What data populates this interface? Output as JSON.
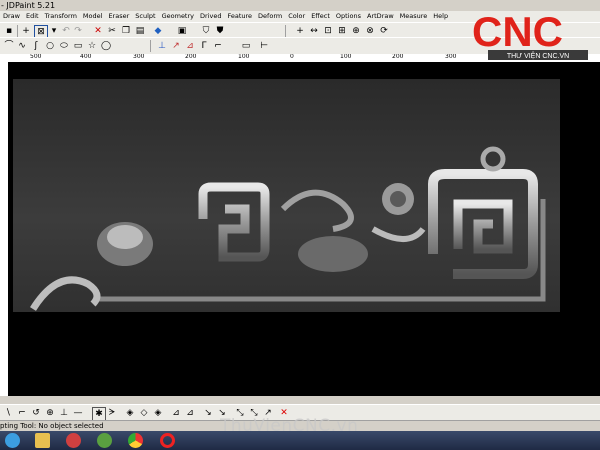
{
  "window": {
    "title": "- JDPaint 5.21"
  },
  "menu": [
    "Draw",
    "Edit",
    "Transform",
    "Model",
    "Eraser",
    "Sculpt",
    "Geometry",
    "Drived",
    "Feature",
    "Deform",
    "Color",
    "Effect",
    "Options",
    "ArtDraw",
    "Measure",
    "Help"
  ],
  "ruler": {
    "labels": [
      "500",
      "400",
      "300",
      "200",
      "100",
      "0",
      "100",
      "200",
      "300",
      "400",
      "500"
    ]
  },
  "status": {
    "text": "pting Tool: No object selected"
  },
  "logo": {
    "brand": "CNC",
    "subtitle": "THƯ VIỆN CNC.VN"
  },
  "watermark": {
    "text": "ThuVienCNC.vn"
  },
  "colors": {
    "brand_red": "#e0231a",
    "canvas": "#000000",
    "ui": "#ecebe6"
  },
  "icons": {
    "toolbar1": [
      "save-icon",
      "crosshair-icon",
      "select-icon",
      "undo-icon",
      "redo-icon",
      "delete-icon",
      "cut-icon",
      "copy-icon",
      "paste-icon",
      "layer-icon",
      "shield-icon",
      "move-icon",
      "pan-icon",
      "zoom-fit-icon",
      "zoom-in-icon",
      "zoom-out-icon",
      "rotate-icon"
    ],
    "toolbar2": [
      "arc-icon",
      "curve-icon",
      "circle-icon",
      "ellipse-icon",
      "rectangle-icon",
      "star-icon",
      "poly-icon",
      "node-icon",
      "line-icon",
      "trim-icon",
      "extend-icon",
      "offset-icon"
    ],
    "bottom": [
      "sculpt-1-icon",
      "sculpt-2-icon",
      "sculpt-3-icon",
      "sculpt-4-icon",
      "sculpt-5-icon",
      "sculpt-6-icon",
      "sculpt-7-icon",
      "sculpt-8-icon",
      "sculpt-9-icon",
      "sculpt-10-icon",
      "sculpt-11-icon",
      "sculpt-12-icon",
      "sculpt-13-icon",
      "sculpt-14-icon",
      "close-icon"
    ]
  }
}
